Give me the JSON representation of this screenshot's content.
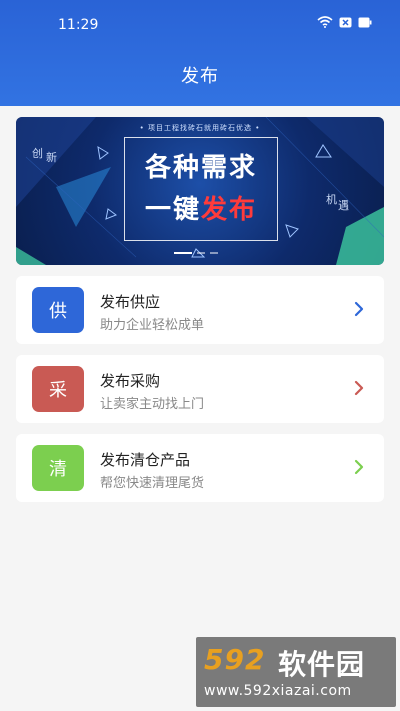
{
  "status_bar": {
    "time": "11:29",
    "wifi_icon": "wifi-icon",
    "battery_icon": "battery-icon"
  },
  "header": {
    "title": "发布"
  },
  "banner": {
    "topline": "• 项目工程找砖石就用砖石优选 •",
    "headline_1": "各种需求",
    "headline_2_a": "一键",
    "headline_2_b": "发布",
    "tag_left_1": "创",
    "tag_left_2": "新",
    "tag_right_1": "机",
    "tag_right_2": "遇",
    "accent_color": "#ff3b3b"
  },
  "items": [
    {
      "icon_text": "供",
      "title": "发布供应",
      "subtitle": "助力企业轻松成单",
      "color": "#2e67d8",
      "arrow_color": "#2e67d8"
    },
    {
      "icon_text": "采",
      "title": "发布采购",
      "subtitle": "让卖家主动找上门",
      "color": "#c95a54",
      "arrow_color": "#c95a54"
    },
    {
      "icon_text": "清",
      "title": "发布清仓产品",
      "subtitle": "帮您快速清理尾货",
      "color": "#7ccf4f",
      "arrow_color": "#7ccf4f"
    }
  ],
  "watermark": {
    "logo_num": "592",
    "logo_cn": "软件园",
    "url": "www.592xiazai.com"
  }
}
